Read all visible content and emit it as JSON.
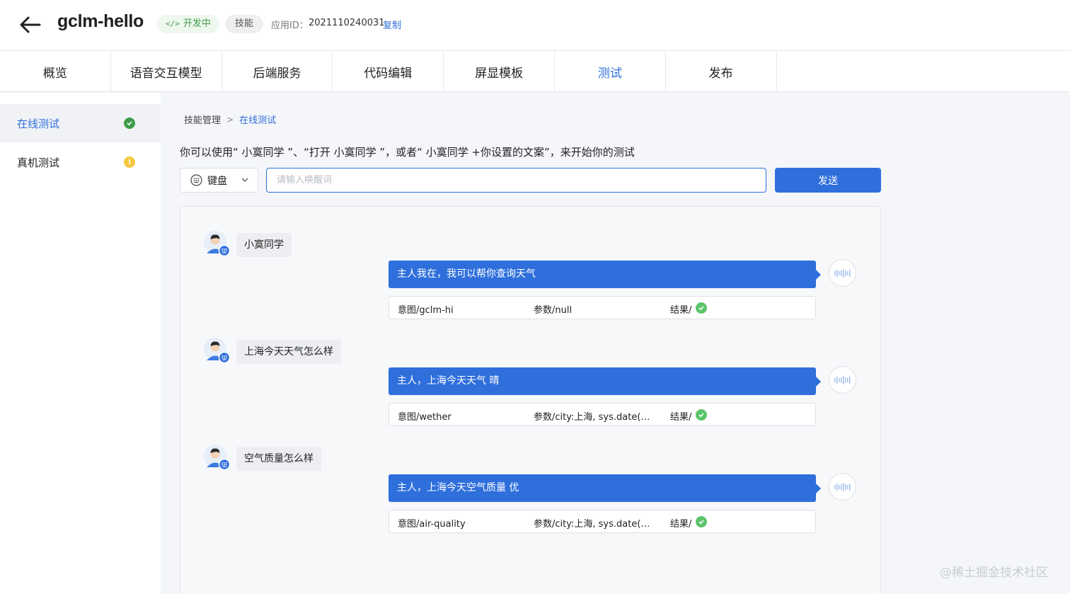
{
  "header": {
    "app_name": "gclm-hello",
    "status_tag": "开发中",
    "status_code_icon": "</>",
    "type_tag": "技能",
    "app_id_label": "应用ID：",
    "app_id_value": "2021110240031",
    "copy_label": "复制"
  },
  "tabs": [
    {
      "label": "概览"
    },
    {
      "label": "语音交互模型"
    },
    {
      "label": "后端服务"
    },
    {
      "label": "代码编辑"
    },
    {
      "label": "屏显模板"
    },
    {
      "label": "测试",
      "active": true
    },
    {
      "label": "发布"
    }
  ],
  "sidebar": {
    "items": [
      {
        "label": "在线测试",
        "status": "ok",
        "status_color": "#3f9b4a"
      },
      {
        "label": "真机测试",
        "status": "warning",
        "status_color": "#f5c842",
        "status_glyph": "!"
      }
    ]
  },
  "breadcrumb": {
    "parent": "技能管理",
    "current": "在线测试"
  },
  "hint": "你可以使用“ 小寞同学 ”、“打开 小寞同学 ”，或者“ 小寞同学 +你设置的文案”，来开始你的测试",
  "input_mode": {
    "selected": "键盘"
  },
  "wake_input": {
    "value": "",
    "placeholder": "请输入唤醒词"
  },
  "send_label": "发送",
  "conversation": [
    {
      "user": "小寞同学",
      "bot": "主人我在，我可以帮你查询天气",
      "intent": "意图/gclm-hi",
      "params": "参数/null",
      "result": "结果/"
    },
    {
      "user": "上海今天天气怎么样",
      "bot": "主人，上海今天天气 晴",
      "intent": "意图/wether",
      "params": "参数/city:上海, sys.date(公…",
      "result": "结果/"
    },
    {
      "user": "空气质量怎么样",
      "bot": "主人，上海今天空气质量 优",
      "intent": "意图/air-quality",
      "params": "参数/city:上海, sys.date(公…",
      "result": "结果/"
    }
  ],
  "colors": {
    "accent": "#2f6fdc",
    "success": "#5cc46a"
  },
  "watermark": "@稀土掘金技术社区"
}
